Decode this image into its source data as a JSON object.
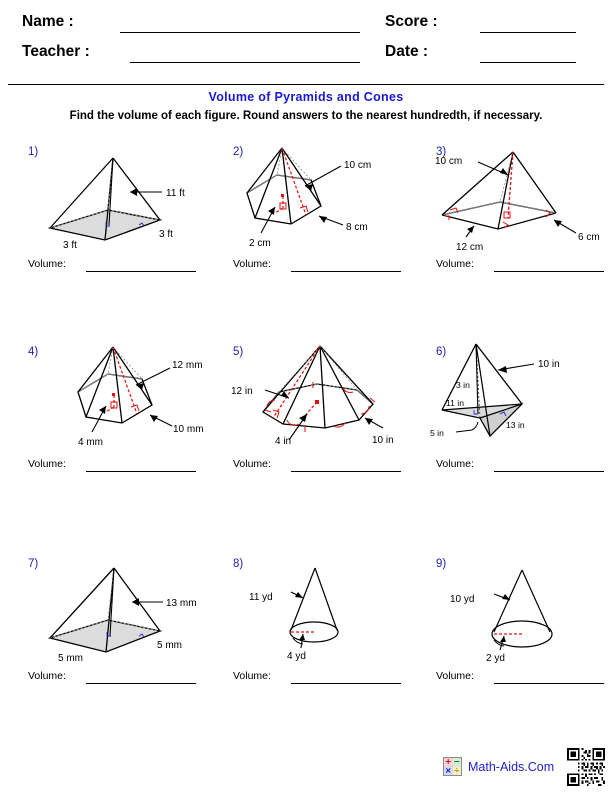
{
  "header": {
    "name_label": "Name :",
    "teacher_label": "Teacher :",
    "score_label": "Score :",
    "date_label": "Date :",
    "name_value": "",
    "teacher_value": "",
    "score_value": "",
    "date_value": ""
  },
  "title": "Volume of Pyramids and Cones",
  "instructions": "Find the volume of each figure. Round answers to the nearest hundredth, if necessary.",
  "answer_label": "Volume:",
  "colors": {
    "title_blue": "#1a1ad6",
    "problem_number_blue": "#2222aa",
    "brand_blue": "#2222cc",
    "dimension_red": "#e01010",
    "shade_gray": "#d9d9d9",
    "outline_black": "#000000"
  },
  "problems": [
    {
      "number": "1)",
      "shape": "square-pyramid",
      "labels": [
        {
          "text": "11 ft",
          "role": "height"
        },
        {
          "text": "3 ft",
          "role": "base-edge-left"
        },
        {
          "text": "3 ft",
          "role": "base-edge-right"
        }
      ]
    },
    {
      "number": "2)",
      "shape": "hexagonal-pyramid",
      "labels": [
        {
          "text": "10 cm",
          "role": "slant-height"
        },
        {
          "text": "8 cm",
          "role": "base-edge"
        },
        {
          "text": "2 cm",
          "role": "apothem"
        }
      ]
    },
    {
      "number": "3)",
      "shape": "rectangular-pyramid",
      "labels": [
        {
          "text": "10 cm",
          "role": "height"
        },
        {
          "text": "12 cm",
          "role": "base-length"
        },
        {
          "text": "6 cm",
          "role": "base-width"
        }
      ]
    },
    {
      "number": "4)",
      "shape": "hexagonal-pyramid",
      "labels": [
        {
          "text": "12 mm",
          "role": "slant-height"
        },
        {
          "text": "10 mm",
          "role": "base-edge"
        },
        {
          "text": "4 mm",
          "role": "apothem"
        }
      ]
    },
    {
      "number": "5)",
      "shape": "octagonal-pyramid",
      "labels": [
        {
          "text": "12 in",
          "role": "slant-height"
        },
        {
          "text": "4 in",
          "role": "apothem"
        },
        {
          "text": "10 in",
          "role": "base-edge"
        }
      ]
    },
    {
      "number": "6)",
      "shape": "quadrilateral-pyramid",
      "labels": [
        {
          "text": "10 in",
          "role": "lateral-edge"
        },
        {
          "text": "3 in",
          "role": "height"
        },
        {
          "text": "11 in",
          "role": "base-diagonal"
        },
        {
          "text": "13 in",
          "role": "base-edge-right"
        },
        {
          "text": "5 in",
          "role": "base-edge-left"
        }
      ]
    },
    {
      "number": "7)",
      "shape": "square-pyramid",
      "labels": [
        {
          "text": "13 mm",
          "role": "height"
        },
        {
          "text": "5 mm",
          "role": "base-edge-left"
        },
        {
          "text": "5 mm",
          "role": "base-edge-right"
        }
      ]
    },
    {
      "number": "8)",
      "shape": "cone",
      "labels": [
        {
          "text": "11 yd",
          "role": "slant-height"
        },
        {
          "text": "4 yd",
          "role": "radius"
        }
      ]
    },
    {
      "number": "9)",
      "shape": "cone",
      "labels": [
        {
          "text": "10 yd",
          "role": "slant-height"
        },
        {
          "text": "2 yd",
          "role": "radius"
        }
      ]
    }
  ],
  "footer": {
    "brand_text": "Math-Aids.Com",
    "calc_icon_symbols": [
      "+",
      "−",
      "×",
      "÷"
    ],
    "qr_code": "qr-code"
  }
}
